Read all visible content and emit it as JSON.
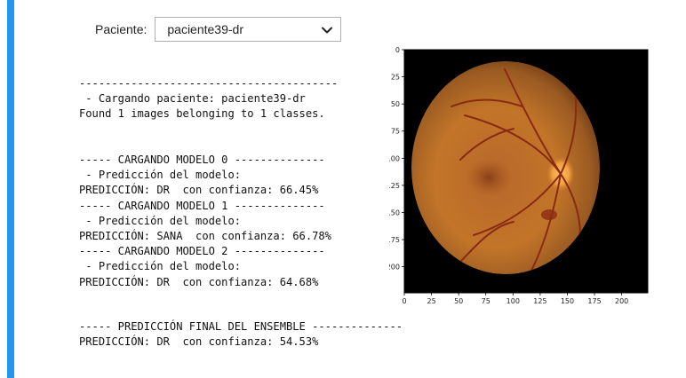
{
  "widget": {
    "label": "Paciente:",
    "selected": "paciente39-dr"
  },
  "output": {
    "block1": [
      "----------------------------------------",
      " - Cargando paciente: paciente39-dr",
      "Found 1 images belonging to 1 classes."
    ],
    "block2": [
      "----- CARGANDO MODELO 0 --------------",
      " - Predicción del modelo:",
      "PREDICCIÓN: DR  con confianza: 66.45%",
      "----- CARGANDO MODELO 1 --------------",
      " - Predicción del modelo:",
      "PREDICCIÓN: SANA  con confianza: 66.78%",
      "----- CARGANDO MODELO 2 --------------",
      " - Predicción del modelo:",
      "PREDICCIÓN: DR  con confianza: 64.68%"
    ],
    "block3": [
      "----- PREDICCIÓN FINAL DEL ENSEMBLE --------------",
      "PREDICCIÓN: DR  con confianza: 54.53%"
    ]
  },
  "plot": {
    "x_ticks": [
      "0",
      "25",
      "50",
      "75",
      "100",
      "125",
      "150",
      "175",
      "200"
    ],
    "y_ticks": [
      "0",
      "25",
      "50",
      "75",
      "100",
      "125",
      "150",
      "175",
      "200"
    ],
    "image_subject": "retinal-fundus-image",
    "colors": {
      "background": "#000000",
      "fundus_center": "#c0752a",
      "fundus_edge": "#6e3a14",
      "optic_disc": "#f0a040",
      "vessel": "#8a2a12"
    }
  }
}
